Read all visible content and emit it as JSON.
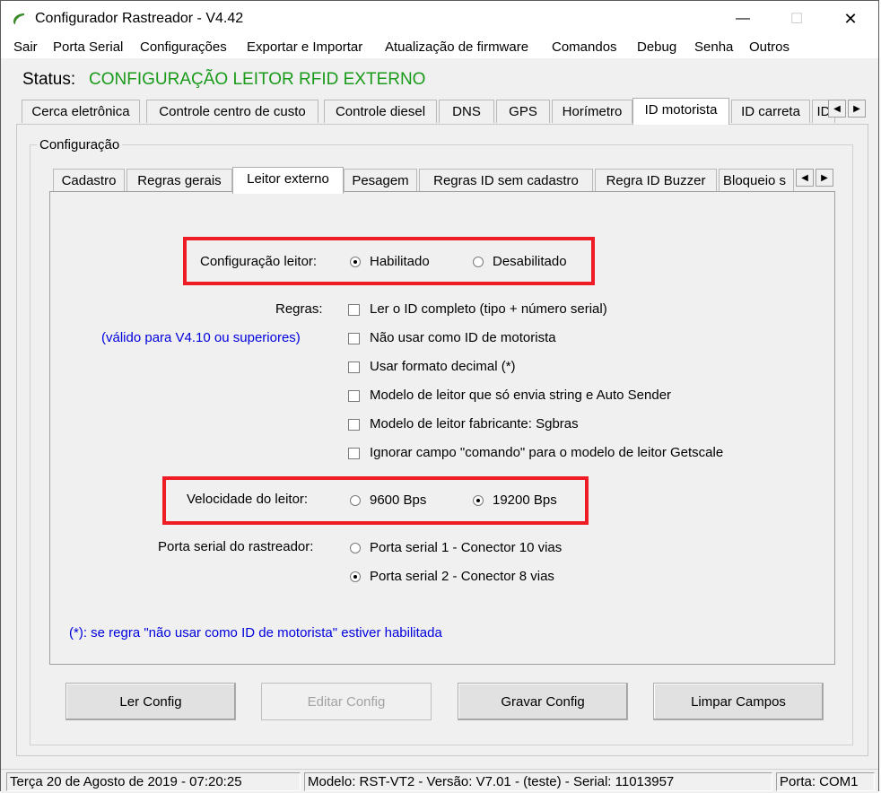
{
  "window": {
    "title": "Configurador Rastreador - V4.42",
    "icon": "app-logo-icon",
    "minimize_glyph": "—",
    "maximize_glyph": "☐",
    "close_glyph": "✕"
  },
  "menu": [
    "Sair",
    "Porta Serial",
    "Configurações",
    "Exportar e Importar",
    "Atualização de firmware",
    "Comandos",
    "Debug",
    "Senha",
    "Outros"
  ],
  "status": {
    "label": "Status:",
    "value": "CONFIGURAÇÃO LEITOR RFID EXTERNO",
    "color": "#1a9a1a"
  },
  "main_tabs": [
    "Cerca eletrônica",
    "Controle centro de custo",
    "Controle diesel",
    "DNS",
    "GPS",
    "Horímetro",
    "ID motorista",
    "ID carreta",
    "ID"
  ],
  "main_tabs_active": "ID motorista",
  "group_title": "Configuração",
  "sub_tabs": [
    "Cadastro",
    "Regras gerais",
    "Leitor externo",
    "Pesagem",
    "Regras ID sem cadastro",
    "Regra ID Buzzer",
    "Bloqueio s"
  ],
  "sub_tabs_active": "Leitor externo",
  "arrows": {
    "left": "◀",
    "right": "▶"
  },
  "config_leitor": {
    "label": "Configuração leitor:",
    "options": [
      "Habilitado",
      "Desabilitado"
    ],
    "selected": "Habilitado"
  },
  "regras": {
    "label": "Regras:",
    "note": "(válido para V4.10 ou superiores)",
    "items": [
      {
        "label": "Ler o ID completo (tipo + número serial)",
        "checked": false
      },
      {
        "label": "Não usar como ID de motorista",
        "checked": false
      },
      {
        "label": "Usar formato decimal (*)",
        "checked": false
      },
      {
        "label": "Modelo de leitor que só envia string e Auto Sender",
        "checked": false
      },
      {
        "label": "Modelo de leitor fabricante: Sgbras",
        "checked": false
      },
      {
        "label": "Ignorar campo \"comando\" para o modelo de leitor Getscale",
        "checked": false
      }
    ]
  },
  "velocidade": {
    "label": "Velocidade do leitor:",
    "options": [
      "9600 Bps",
      "19200 Bps"
    ],
    "selected": "19200 Bps"
  },
  "porta_serial": {
    "label": "Porta serial do rastreador:",
    "options": [
      "Porta serial 1 - Conector 10 vias",
      "Porta serial 2 - Conector 8 vias"
    ],
    "selected": "Porta serial 2 - Conector 8 vias"
  },
  "footnote": "(*): se regra \"não usar como ID de motorista\" estiver habilitada",
  "buttons": {
    "ler": "Ler Config",
    "editar": "Editar Config",
    "gravar": "Gravar Config",
    "limpar": "Limpar Campos"
  },
  "statusbar": {
    "datetime": "Terça 20 de Agosto de 2019  -  07:20:25",
    "modelo": "Modelo: RST-VT2  -  Versão: V7.01 - (teste)  -  Serial: 11013957",
    "porta": "Porta: COM1"
  },
  "colors": {
    "highlight_box": "#ee1c24",
    "note_text": "#0000dd"
  }
}
